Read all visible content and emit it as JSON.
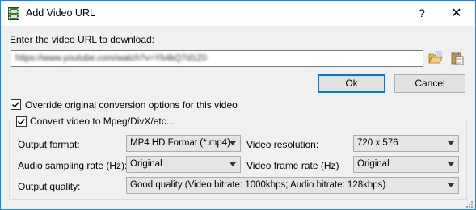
{
  "window": {
    "title": "Add Video URL",
    "help_label": "?",
    "close_label": "✕"
  },
  "url_section": {
    "prompt": "Enter the video URL to download:",
    "value": "https://www.youtube.com/watch?v=Yb4kQ7d1Z0",
    "value_blurred": true
  },
  "buttons": {
    "ok": "Ok",
    "cancel": "Cancel"
  },
  "options": {
    "override_label": "Override original conversion options for this video",
    "override_checked": true,
    "convert_label": "Convert video to Mpeg/DivX/etc...",
    "convert_checked": true
  },
  "fields": {
    "output_format_label": "Output format:",
    "output_format_value": "MP4 HD Format (*.mp4)",
    "video_resolution_label": "Video resolution:",
    "video_resolution_value": "720 x 576",
    "audio_rate_label": "Audio sampling rate (Hz):",
    "audio_rate_value": "Original",
    "frame_rate_label": "Video frame rate (Hz)",
    "frame_rate_value": "Original",
    "quality_label": "Output quality:",
    "quality_value": "Good quality (Video bitrate: 1000kbps; Audio bitrate: 128kbps)"
  },
  "colors": {
    "accent": "#0078d7",
    "window_border": "#1883d7",
    "background": "#f0f0f0"
  },
  "icons": [
    "film-icon",
    "help-icon",
    "close-icon",
    "folder-open-icon",
    "paste-icon",
    "checkmark-icon",
    "dropdown-arrow-icon",
    "resize-grip-icon"
  ]
}
